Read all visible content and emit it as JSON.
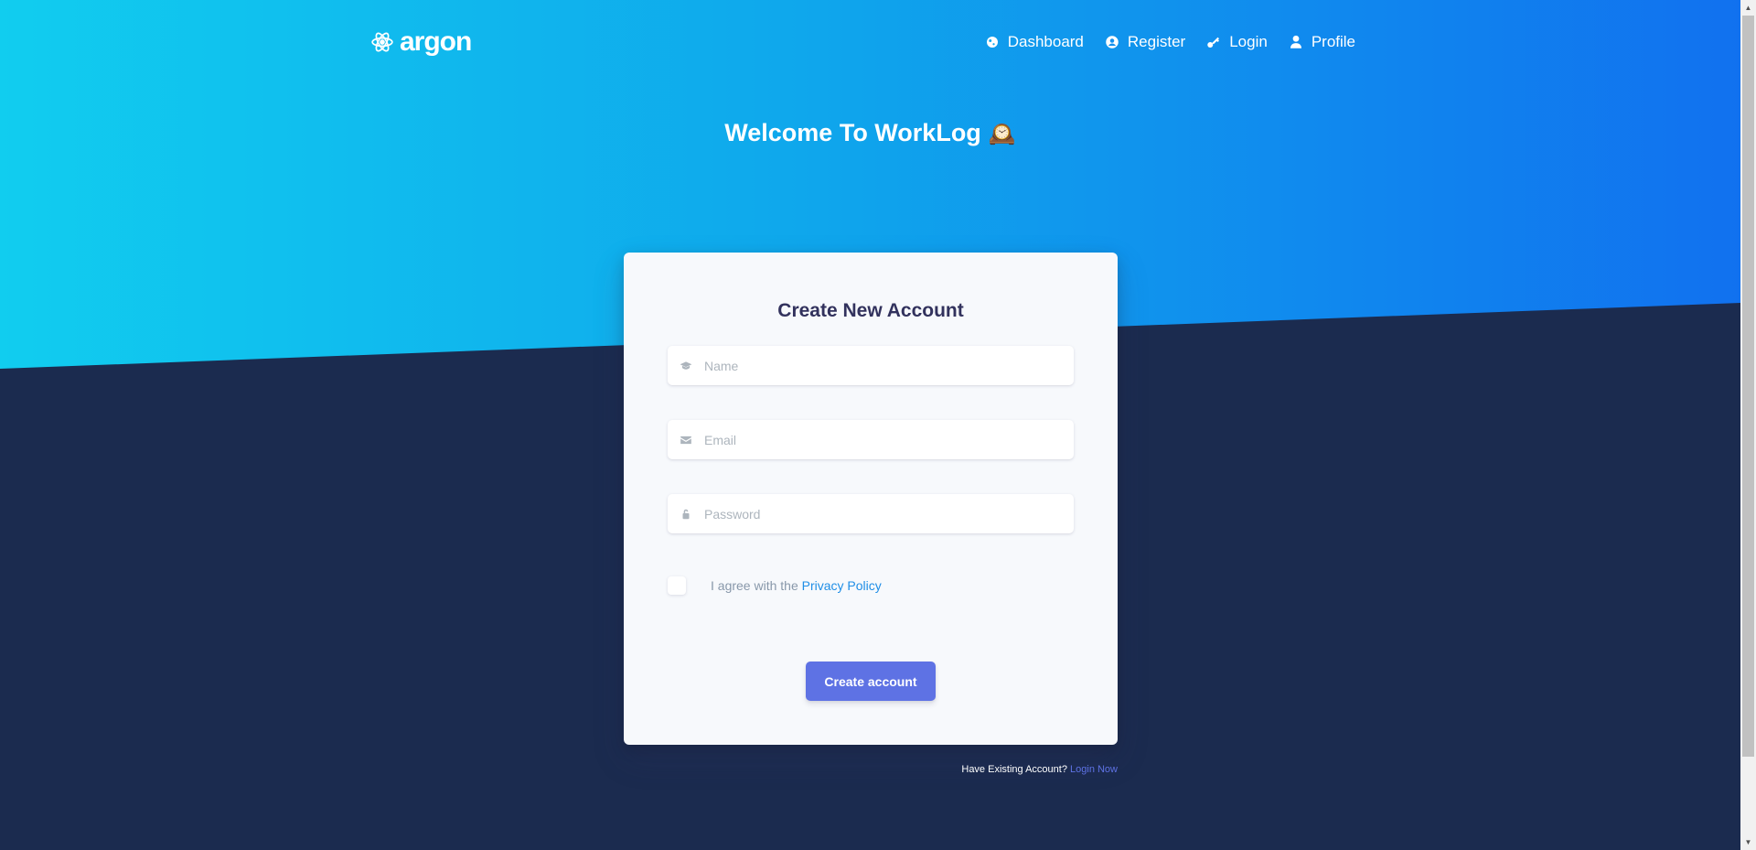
{
  "nav": {
    "brand": "argon",
    "links": [
      {
        "label": "Dashboard",
        "icon": "planet-icon"
      },
      {
        "label": "Register",
        "icon": "user-circle-icon"
      },
      {
        "label": "Login",
        "icon": "key-icon"
      },
      {
        "label": "Profile",
        "icon": "user-icon"
      }
    ]
  },
  "hero": {
    "title": "Welcome To WorkLog",
    "emoji": "🕰️"
  },
  "form": {
    "title": "Create New Account",
    "name_placeholder": "Name",
    "email_placeholder": "Email",
    "password_placeholder": "Password",
    "agree_text": "I agree with the",
    "privacy_link": "Privacy Policy",
    "submit_label": "Create account"
  },
  "footer": {
    "text": "Have Existing Account?",
    "link": "Login Now"
  },
  "colors": {
    "primary": "#5e72e4",
    "hero_start": "#11cdef",
    "hero_end": "#1171ef",
    "background": "#1b2b4f"
  }
}
